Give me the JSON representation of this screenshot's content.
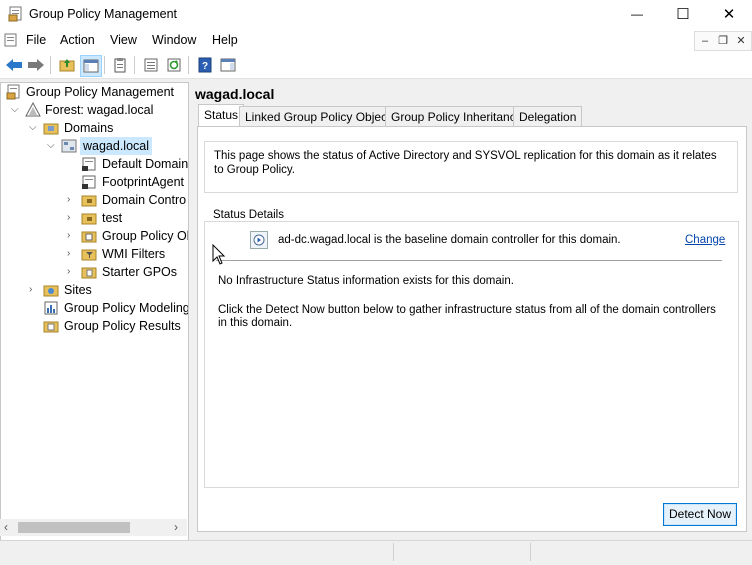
{
  "window": {
    "title": "Group Policy Management",
    "controls": {
      "minimize": "—",
      "maximize": "☐",
      "close": "✕"
    }
  },
  "menu": {
    "items": [
      "File",
      "Action",
      "View",
      "Window",
      "Help"
    ],
    "mdi": {
      "minimize": "–",
      "restore": "❐",
      "close": "✕"
    }
  },
  "tree": {
    "root": "Group Policy Management",
    "forest": "Forest: wagad.local",
    "domains": "Domains",
    "domain": "wagad.local",
    "children": [
      "Default Domain",
      "FootprintAgent",
      "Domain Contro",
      "test",
      "Group Policy Ob",
      "WMI Filters",
      "Starter GPOs"
    ],
    "sites": "Sites",
    "modeling": "Group Policy Modeling",
    "results": "Group Policy Results"
  },
  "main": {
    "title": "wagad.local",
    "tabs": [
      "Status",
      "Linked Group Policy Objects",
      "Group Policy Inheritance",
      "Delegation"
    ],
    "intro": "This page shows the status of Active Directory and SYSVOL replication for this domain as it relates to Group Policy.",
    "status_details_label": "Status Details",
    "baseline_text": "ad-dc.wagad.local is the baseline domain controller for this domain.",
    "change_link": "Change",
    "infra_text": "No Infrastructure Status information exists for this domain.",
    "detect_text": "Click the Detect Now button below to gather infrastructure status from all of the domain controllers in this domain.",
    "detect_button": "Detect Now"
  },
  "colors": {
    "accent": "#0078d7",
    "selection": "#cce8ff",
    "link": "#0645ad"
  }
}
